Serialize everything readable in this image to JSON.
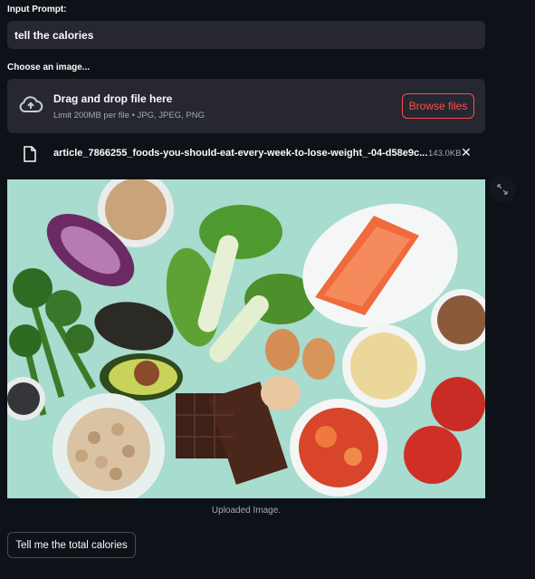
{
  "prompt": {
    "label": "Input Prompt:",
    "value": "tell the calories"
  },
  "uploader": {
    "label": "Choose an image...",
    "dropzone_title": "Drag and drop file here",
    "dropzone_subtitle": "Limit 200MB per file • JPG, JPEG, PNG",
    "browse_label": "Browse files",
    "icon": "cloud-upload-icon",
    "accent_color": "#ff4b4b"
  },
  "uploaded_file": {
    "name": "article_7866255_foods-you-should-eat-every-week-to-lose-weight_-04-d58e9c...",
    "size": "143.0KB",
    "icon": "file-icon",
    "remove_icon": "close-icon"
  },
  "image": {
    "caption": "Uploaded Image.",
    "expand_icon": "fullscreen-icon"
  },
  "action": {
    "button_label": "Tell me the total calories"
  },
  "theme": {
    "background": "#0e1117",
    "surface": "#262730",
    "text": "#fafafa",
    "muted": "#a3a8b8"
  }
}
